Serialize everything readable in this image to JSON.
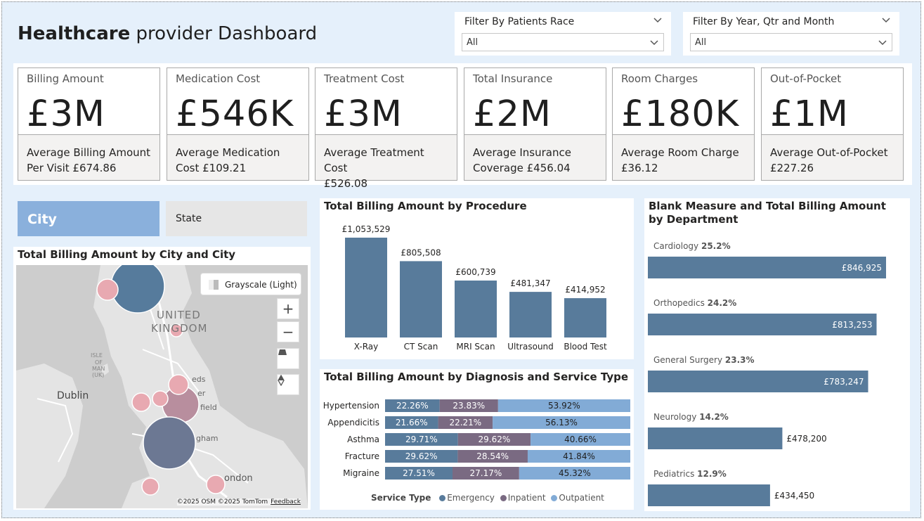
{
  "dashboard": {
    "title_bold": "Healthcare",
    "title_rest": " provider Dashboard"
  },
  "filters": {
    "race": {
      "label": "Filter By Patients Race",
      "value": "All"
    },
    "period": {
      "label": "Filter By Year, Qtr and Month",
      "value": "All"
    }
  },
  "kpis": [
    {
      "title": "Billing Amount",
      "value": "£3M",
      "sub1": "Average Billing Amount",
      "sub2": "Per Visit £674.86"
    },
    {
      "title": "Medication Cost",
      "value": "£546K",
      "sub1": "Average Medication",
      "sub2": "Cost £109.21"
    },
    {
      "title": "Treatment Cost",
      "value": "£3M",
      "sub1": "Average Treatment Cost",
      "sub2": "£526.08"
    },
    {
      "title": "Total Insurance",
      "value": "£2M",
      "sub1": "Average Insurance",
      "sub2": "Coverage £456.04"
    },
    {
      "title": "Room Charges",
      "value": "£180K",
      "sub1": "Average Room Charge",
      "sub2": "£36.12"
    },
    {
      "title": "Out-of-Pocket",
      "value": "£1M",
      "sub1": "Average Out-of-Pocket",
      "sub2": "£227.26"
    }
  ],
  "tabs": {
    "city": "City",
    "state": "State"
  },
  "map": {
    "title": "Total Billing Amount by City and City",
    "style_label": "Grayscale (Light)",
    "labels": {
      "country_1": "UNITED",
      "country_2": "KINGDOM",
      "dublin": "Dublin",
      "isle_1": "ISLE",
      "isle_2": "OF",
      "isle_3": "MAN",
      "isle_4": "(UK)",
      "leeds": "eds",
      "hudders": "er",
      "field": "field",
      "gham": "gham",
      "london": "ondon"
    },
    "attribution": "©2025 OSM  ©2025 TomTom",
    "feedback": "Feedback",
    "zoom_in": "+",
    "zoom_out": "−"
  },
  "chart_data": [
    {
      "type": "bar",
      "title": "Total Billing Amount by Procedure",
      "categories": [
        "X-Ray",
        "CT Scan",
        "MRI Scan",
        "Ultrasound",
        "Blood Test"
      ],
      "values": [
        1053529,
        805508,
        600739,
        481347,
        414952
      ],
      "value_labels": [
        "£1,053,529",
        "£805,508",
        "£600,739",
        "£481,347",
        "£414,952"
      ],
      "color": "#587b9b"
    },
    {
      "type": "bar",
      "orientation": "horizontal-stacked-100",
      "title": "Total Billing Amount by Diagnosis and Service Type",
      "categories": [
        "Hypertension",
        "Appendicitis",
        "Asthma",
        "Fracture",
        "Migraine"
      ],
      "legend_title": "Service Type",
      "series": [
        {
          "name": "Emergency",
          "color": "#587b9b",
          "values": [
            22.26,
            21.66,
            29.71,
            29.62,
            27.51
          ]
        },
        {
          "name": "Inpatient",
          "color": "#7a6a82",
          "values": [
            23.83,
            22.21,
            29.62,
            28.54,
            27.17
          ]
        },
        {
          "name": "Outpatient",
          "color": "#82abd6",
          "values": [
            53.92,
            56.13,
            40.66,
            41.84,
            45.32
          ]
        }
      ],
      "value_labels": [
        [
          "22.26%",
          "23.83%",
          "53.92%"
        ],
        [
          "21.66%",
          "22.21%",
          "56.13%"
        ],
        [
          "29.71%",
          "29.62%",
          "40.66%"
        ],
        [
          "29.62%",
          "28.54%",
          "41.84%"
        ],
        [
          "27.51%",
          "27.17%",
          "45.32%"
        ]
      ]
    },
    {
      "type": "bar",
      "orientation": "horizontal",
      "title": "Blank Measure and Total Billing Amount by Department",
      "categories": [
        "Cardiology",
        "Orthopedics",
        "General Surgery",
        "Neurology",
        "Pediatrics"
      ],
      "percentages": [
        "25.2%",
        "24.2%",
        "23.3%",
        "14.2%",
        "12.9%"
      ],
      "values": [
        846925,
        813253,
        783247,
        478200,
        434450
      ],
      "value_labels": [
        "£846,925",
        "£813,253",
        "£783,247",
        "£478,200",
        "£434,450"
      ],
      "color": "#587b9b"
    }
  ],
  "colors": {
    "bar": "#587b9b",
    "canvas": "#e5f0fb",
    "bubble_large": "#567b9c",
    "bubble_mid": "#6c7893",
    "bubble_pink": "#e8a9b1"
  }
}
